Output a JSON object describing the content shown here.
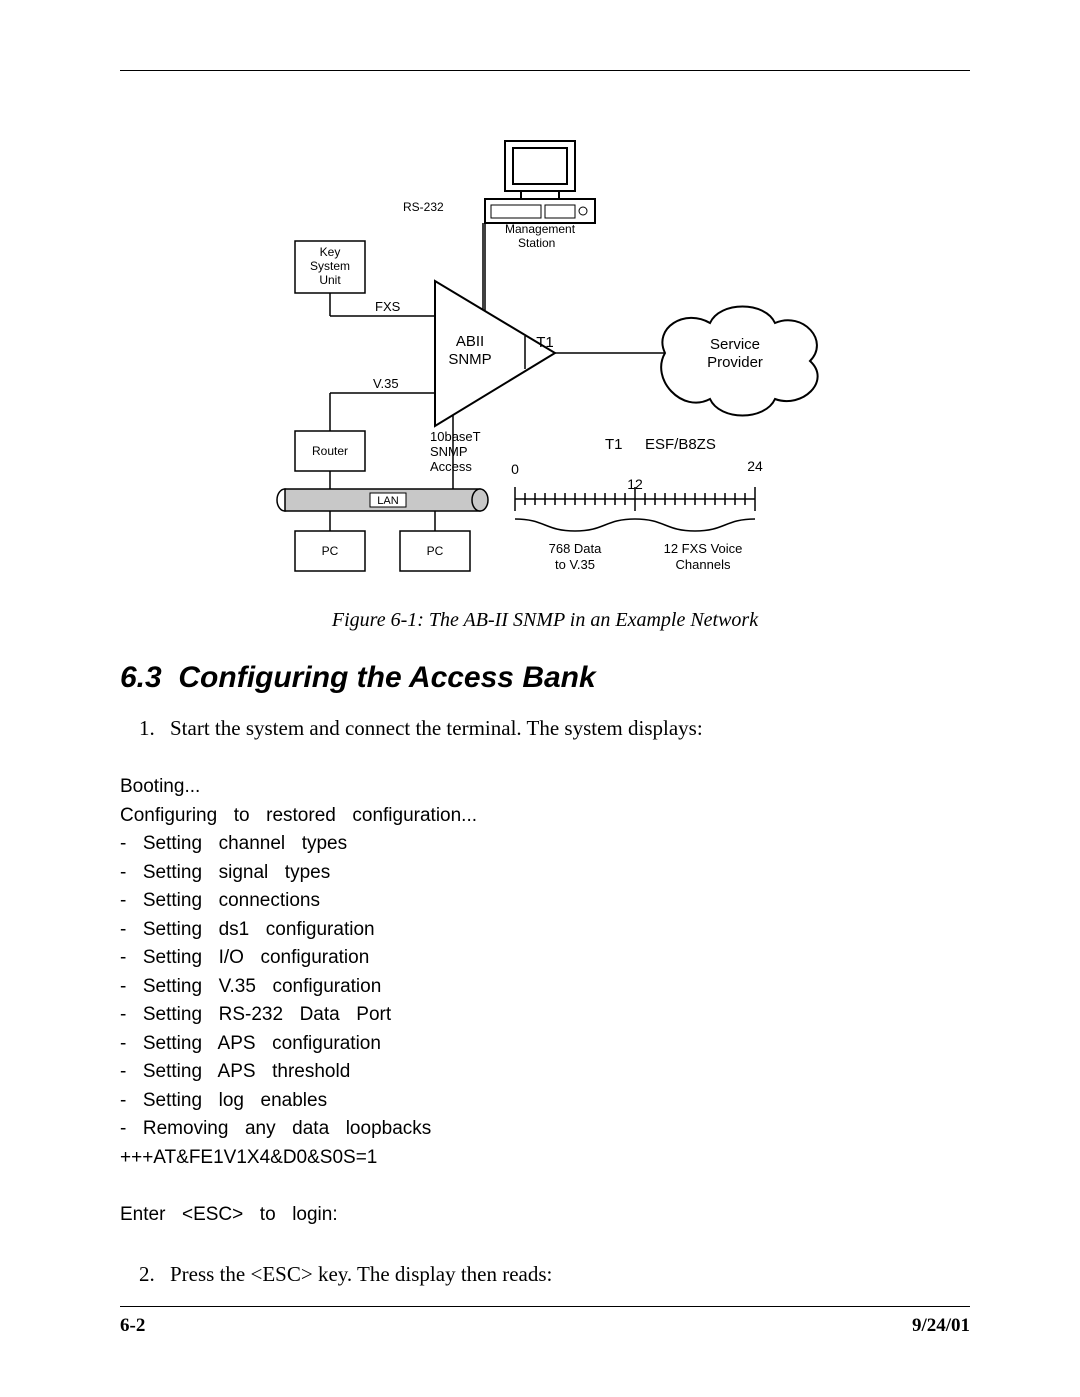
{
  "figure": {
    "labels": {
      "rs232": "RS-232",
      "mgmt1": "Management",
      "mgmt2": "Station",
      "ksu1": "Key",
      "ksu2": "System",
      "ksu3": "Unit",
      "fxs": "FXS",
      "abii1": "ABII",
      "abii2": "SNMP",
      "t1_left": "T1",
      "sp1": "Service",
      "sp2": "Provider",
      "v35": "V.35",
      "router": "Router",
      "tenb1": "10baseT",
      "tenb2": "SNMP",
      "tenb3": "Access",
      "lan": "LAN",
      "pc": "PC",
      "t1_right": "T1",
      "esf": "ESF/B8ZS",
      "r0": "0",
      "r12": "12",
      "r24": "24",
      "br1a": "768 Data",
      "br1b": "to V.35",
      "br2a": "12 FXS Voice",
      "br2b": "Channels"
    },
    "caption": "Figure 6-1: The AB-II SNMP in an Example Network"
  },
  "section": {
    "number": "6.3",
    "title": "Configuring the Access Bank"
  },
  "steps": {
    "s1": "Start the system and connect the terminal. The system displays:",
    "s2": "Press the <ESC> key.  The display then reads:"
  },
  "terminal": "Booting...\nConfiguring  to  restored  configuration...\n-  Setting  channel  types\n-  Setting  signal  types\n-  Setting  connections\n-  Setting  ds1  configuration\n-  Setting  I/O  configuration\n-  Setting  V.35  configuration\n-  Setting  RS-232  Data  Port\n-  Setting  APS  configuration\n-  Setting  APS  threshold\n-  Setting  log  enables\n-  Removing  any  data  loopbacks\n+++AT&FE1V1X4&D0&S0S=1\n\nEnter  <ESC>  to  login:",
  "footer": {
    "page": "6-2",
    "date": "9/24/01"
  }
}
